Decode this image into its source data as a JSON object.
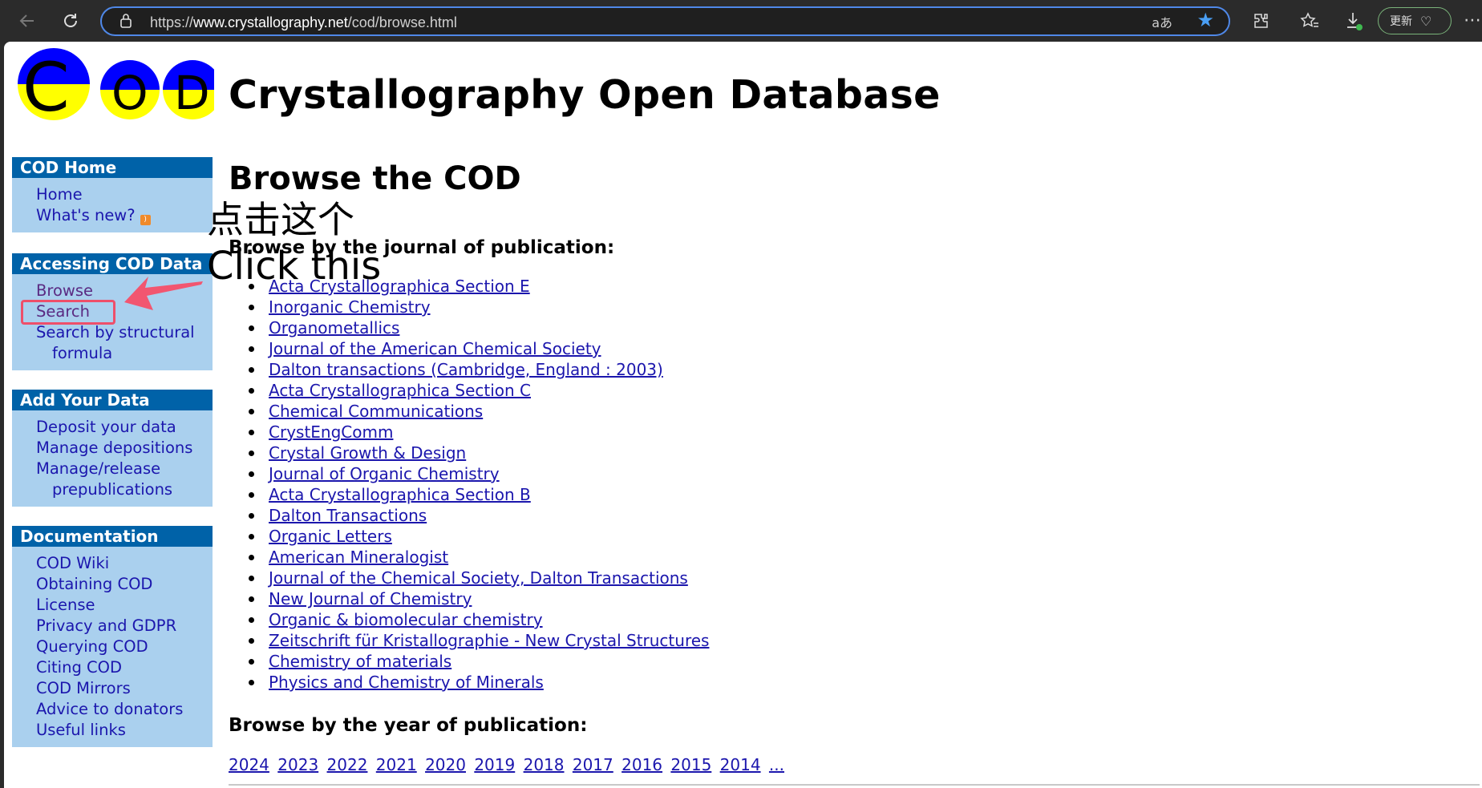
{
  "browser": {
    "url_prefix": "https://",
    "url_host": "www.crystallography.net",
    "url_path": "/cod/browse.html",
    "update_label": "更新",
    "icons": [
      "back-icon",
      "refresh-icon",
      "lock-icon",
      "read-aloud-icon",
      "favorite-star-icon",
      "extensions-icon",
      "favorites-icon",
      "downloads-icon",
      "more-icon"
    ],
    "accent_color": "#4f88e8"
  },
  "site": {
    "logo_letters": [
      "C",
      "O",
      "D"
    ],
    "title": "Crystallography Open Database"
  },
  "sidebar": {
    "sections": [
      {
        "title": "COD Home",
        "items": [
          "Home",
          "What's new?"
        ]
      },
      {
        "title": "Accessing COD Data",
        "items": [
          "Browse",
          "Search",
          "Search by structural",
          "formula"
        ]
      },
      {
        "title": "Add Your Data",
        "items": [
          "Deposit your data",
          "Manage depositions",
          "Manage/release",
          "prepublications"
        ]
      },
      {
        "title": "Documentation",
        "items": [
          "COD Wiki",
          "Obtaining COD",
          "License",
          "Privacy and GDPR",
          "Querying COD",
          "Citing COD",
          "COD Mirrors",
          "Advice to donators",
          "Useful links"
        ]
      }
    ]
  },
  "main": {
    "heading": "Browse the COD",
    "journal_heading": "Browse by the journal of publication:",
    "journals": [
      "Acta Crystallographica Section E",
      "Inorganic Chemistry",
      "Organometallics",
      "Journal of the American Chemical Society",
      "Dalton transactions (Cambridge, England : 2003)",
      "Acta Crystallographica Section C",
      "Chemical Communications",
      "CrystEngComm",
      "Crystal Growth & Design",
      "Journal of Organic Chemistry",
      "Acta Crystallographica Section B",
      "Dalton Transactions",
      "Organic Letters",
      "American Mineralogist",
      "Journal of the Chemical Society, Dalton Transactions",
      "New Journal of Chemistry",
      "Organic & biomolecular chemistry",
      "Zeitschrift für Kristallographie - New Crystal Structures",
      "Chemistry of materials",
      "Physics and Chemistry of Minerals"
    ],
    "year_heading": "Browse by the year of publication:",
    "years": [
      "2024",
      "2023",
      "2022",
      "2021",
      "2020",
      "2019",
      "2018",
      "2017",
      "2016",
      "2015",
      "2014",
      "..."
    ]
  },
  "annotation": {
    "text_cn": "点击这个",
    "text_en": "Click this",
    "color": "#ee4f6a"
  }
}
